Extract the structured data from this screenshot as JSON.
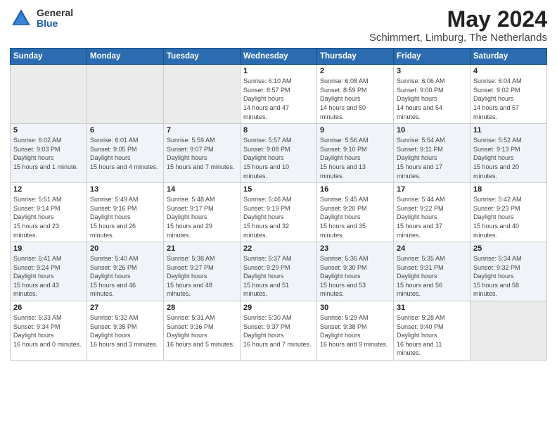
{
  "logo": {
    "general": "General",
    "blue": "Blue"
  },
  "title": {
    "month_year": "May 2024",
    "location": "Schimmert, Limburg, The Netherlands"
  },
  "days_of_week": [
    "Sunday",
    "Monday",
    "Tuesday",
    "Wednesday",
    "Thursday",
    "Friday",
    "Saturday"
  ],
  "weeks": [
    [
      {
        "day": "",
        "empty": true
      },
      {
        "day": "",
        "empty": true
      },
      {
        "day": "",
        "empty": true
      },
      {
        "day": "1",
        "sunrise": "6:10 AM",
        "sunset": "8:57 PM",
        "daylight": "14 hours and 47 minutes."
      },
      {
        "day": "2",
        "sunrise": "6:08 AM",
        "sunset": "8:59 PM",
        "daylight": "14 hours and 50 minutes."
      },
      {
        "day": "3",
        "sunrise": "6:06 AM",
        "sunset": "9:00 PM",
        "daylight": "14 hours and 54 minutes."
      },
      {
        "day": "4",
        "sunrise": "6:04 AM",
        "sunset": "9:02 PM",
        "daylight": "14 hours and 57 minutes."
      }
    ],
    [
      {
        "day": "5",
        "sunrise": "6:02 AM",
        "sunset": "9:03 PM",
        "daylight": "15 hours and 1 minute."
      },
      {
        "day": "6",
        "sunrise": "6:01 AM",
        "sunset": "9:05 PM",
        "daylight": "15 hours and 4 minutes."
      },
      {
        "day": "7",
        "sunrise": "5:59 AM",
        "sunset": "9:07 PM",
        "daylight": "15 hours and 7 minutes."
      },
      {
        "day": "8",
        "sunrise": "5:57 AM",
        "sunset": "9:08 PM",
        "daylight": "15 hours and 10 minutes."
      },
      {
        "day": "9",
        "sunrise": "5:56 AM",
        "sunset": "9:10 PM",
        "daylight": "15 hours and 13 minutes."
      },
      {
        "day": "10",
        "sunrise": "5:54 AM",
        "sunset": "9:11 PM",
        "daylight": "15 hours and 17 minutes."
      },
      {
        "day": "11",
        "sunrise": "5:52 AM",
        "sunset": "9:13 PM",
        "daylight": "15 hours and 20 minutes."
      }
    ],
    [
      {
        "day": "12",
        "sunrise": "5:51 AM",
        "sunset": "9:14 PM",
        "daylight": "15 hours and 23 minutes."
      },
      {
        "day": "13",
        "sunrise": "5:49 AM",
        "sunset": "9:16 PM",
        "daylight": "15 hours and 26 minutes."
      },
      {
        "day": "14",
        "sunrise": "5:48 AM",
        "sunset": "9:17 PM",
        "daylight": "15 hours and 29 minutes."
      },
      {
        "day": "15",
        "sunrise": "5:46 AM",
        "sunset": "9:19 PM",
        "daylight": "15 hours and 32 minutes."
      },
      {
        "day": "16",
        "sunrise": "5:45 AM",
        "sunset": "9:20 PM",
        "daylight": "15 hours and 35 minutes."
      },
      {
        "day": "17",
        "sunrise": "5:44 AM",
        "sunset": "9:22 PM",
        "daylight": "15 hours and 37 minutes."
      },
      {
        "day": "18",
        "sunrise": "5:42 AM",
        "sunset": "9:23 PM",
        "daylight": "15 hours and 40 minutes."
      }
    ],
    [
      {
        "day": "19",
        "sunrise": "5:41 AM",
        "sunset": "9:24 PM",
        "daylight": "15 hours and 43 minutes."
      },
      {
        "day": "20",
        "sunrise": "5:40 AM",
        "sunset": "9:26 PM",
        "daylight": "15 hours and 46 minutes."
      },
      {
        "day": "21",
        "sunrise": "5:38 AM",
        "sunset": "9:27 PM",
        "daylight": "15 hours and 48 minutes."
      },
      {
        "day": "22",
        "sunrise": "5:37 AM",
        "sunset": "9:29 PM",
        "daylight": "15 hours and 51 minutes."
      },
      {
        "day": "23",
        "sunrise": "5:36 AM",
        "sunset": "9:30 PM",
        "daylight": "15 hours and 53 minutes."
      },
      {
        "day": "24",
        "sunrise": "5:35 AM",
        "sunset": "9:31 PM",
        "daylight": "15 hours and 56 minutes."
      },
      {
        "day": "25",
        "sunrise": "5:34 AM",
        "sunset": "9:32 PM",
        "daylight": "15 hours and 58 minutes."
      }
    ],
    [
      {
        "day": "26",
        "sunrise": "5:33 AM",
        "sunset": "9:34 PM",
        "daylight": "16 hours and 0 minutes."
      },
      {
        "day": "27",
        "sunrise": "5:32 AM",
        "sunset": "9:35 PM",
        "daylight": "16 hours and 3 minutes."
      },
      {
        "day": "28",
        "sunrise": "5:31 AM",
        "sunset": "9:36 PM",
        "daylight": "16 hours and 5 minutes."
      },
      {
        "day": "29",
        "sunrise": "5:30 AM",
        "sunset": "9:37 PM",
        "daylight": "16 hours and 7 minutes."
      },
      {
        "day": "30",
        "sunrise": "5:29 AM",
        "sunset": "9:38 PM",
        "daylight": "16 hours and 9 minutes."
      },
      {
        "day": "31",
        "sunrise": "5:28 AM",
        "sunset": "9:40 PM",
        "daylight": "16 hours and 11 minutes."
      },
      {
        "day": "",
        "empty": true
      }
    ]
  ],
  "labels": {
    "sunrise": "Sunrise:",
    "sunset": "Sunset:",
    "daylight": "Daylight hours"
  }
}
